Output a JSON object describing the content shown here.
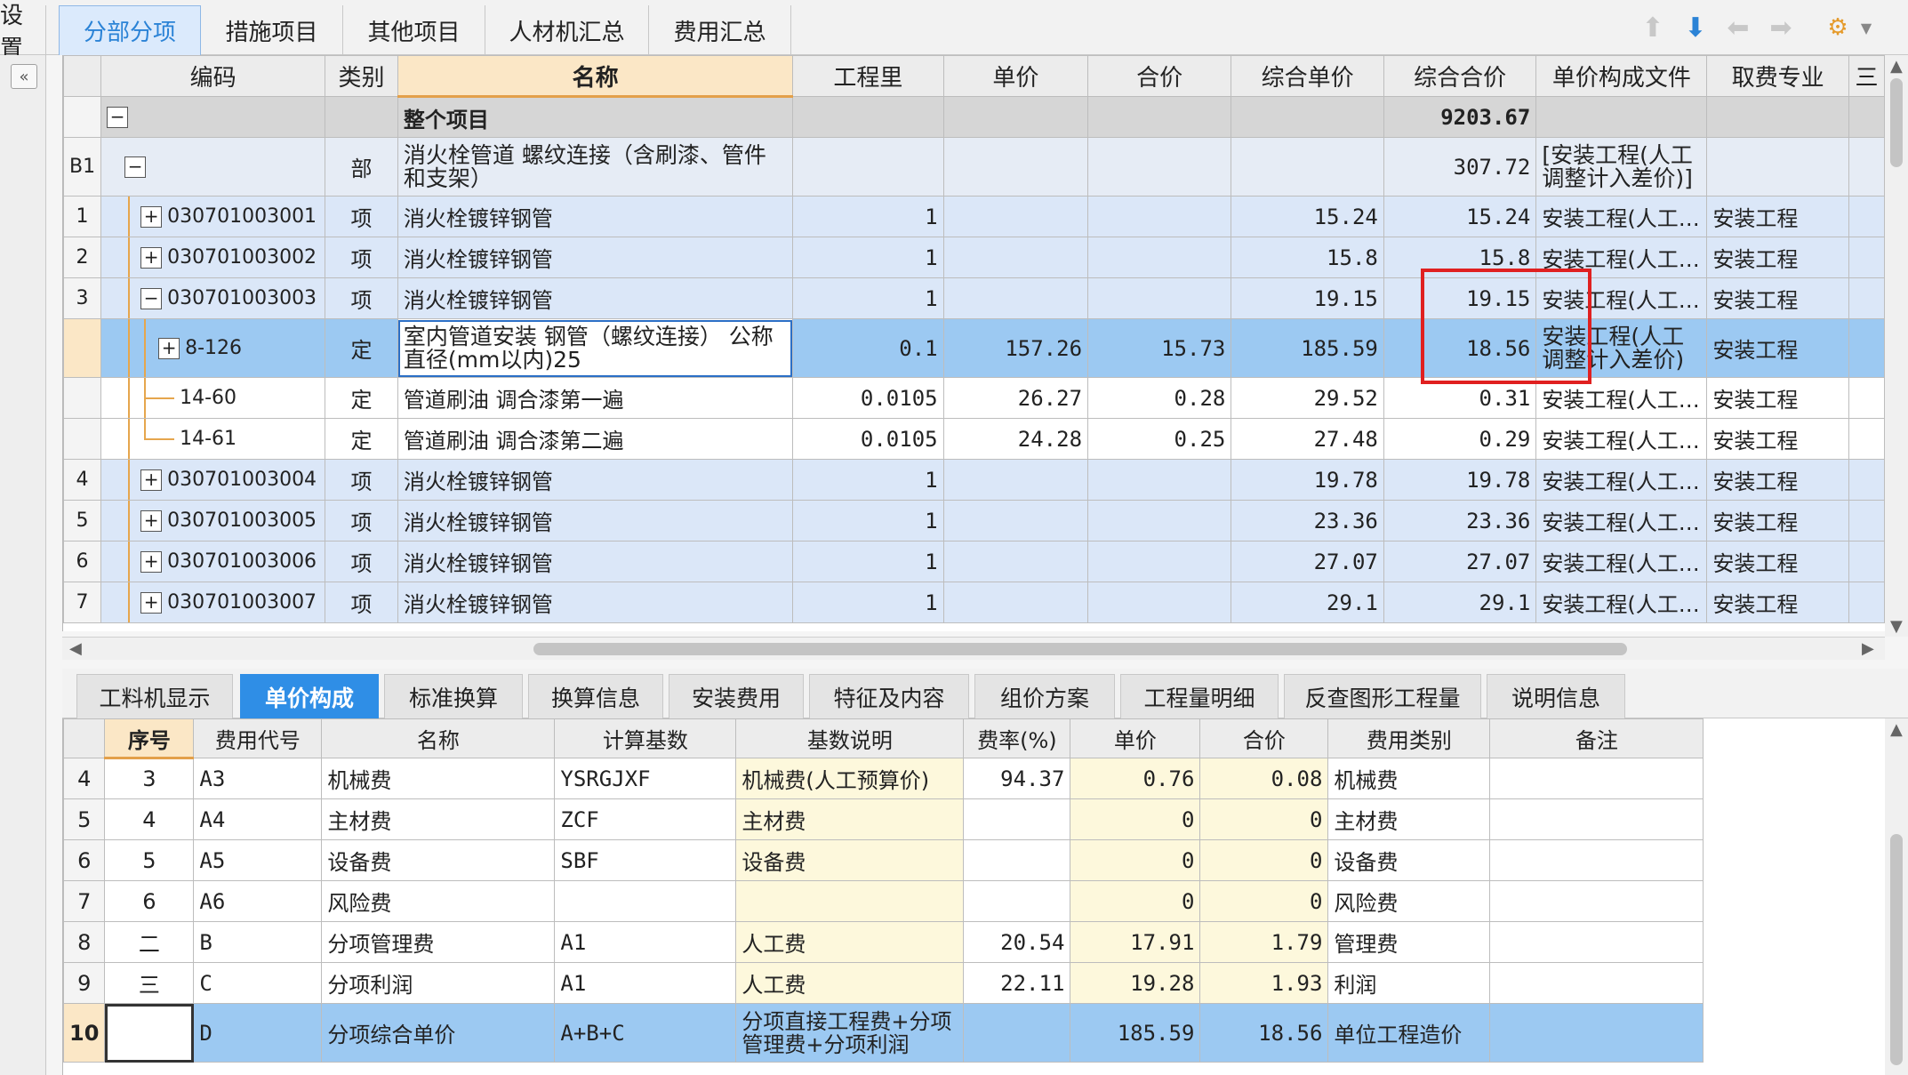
{
  "top_tabs": [
    {
      "label": "设置"
    },
    {
      "label": "分部分项"
    },
    {
      "label": "措施项目"
    },
    {
      "label": "其他项目"
    },
    {
      "label": "人材机汇总"
    },
    {
      "label": "费用汇总"
    }
  ],
  "toolbar_icons": [
    "arrow-up-icon",
    "arrow-down-icon",
    "arrow-left-icon",
    "arrow-right-icon",
    "settings-icon"
  ],
  "grid": {
    "headers": [
      "编码",
      "类别",
      "名称",
      "工程里",
      "单价",
      "合价",
      "综合单价",
      "综合合价",
      "单价构成文件",
      "取费专业",
      "三"
    ],
    "rows": [
      {
        "no": "",
        "code": "",
        "type": "",
        "name": "整个项目",
        "qty": "",
        "price": "",
        "total": "",
        "unit_comp": "",
        "total_comp": "9203.67",
        "file": "",
        "spec": ""
      },
      {
        "no": "B1",
        "code": "",
        "type": "部",
        "name": "消火栓管道 螺纹连接（含刷漆、管件和支架）",
        "qty": "",
        "price": "",
        "total": "",
        "unit_comp": "",
        "total_comp": "307.72",
        "file": "[安装工程(人工调整计入差价)]",
        "spec": ""
      },
      {
        "no": "1",
        "code": "030701003001",
        "type": "项",
        "name": "消火栓镀锌钢管",
        "qty": "1",
        "price": "",
        "total": "",
        "unit_comp": "15.24",
        "total_comp": "15.24",
        "file": "安装工程(人工…",
        "spec": "安装工程"
      },
      {
        "no": "2",
        "code": "030701003002",
        "type": "项",
        "name": "消火栓镀锌钢管",
        "qty": "1",
        "price": "",
        "total": "",
        "unit_comp": "15.8",
        "total_comp": "15.8",
        "file": "安装工程(人工…",
        "spec": "安装工程"
      },
      {
        "no": "3",
        "code": "030701003003",
        "type": "项",
        "name": "消火栓镀锌钢管",
        "qty": "1",
        "price": "",
        "total": "",
        "unit_comp": "19.15",
        "total_comp": "19.15",
        "file": "安装工程(人工…",
        "spec": "安装工程"
      },
      {
        "no": "",
        "code": "8-126",
        "type": "定",
        "name": "室内管道安装 钢管（螺纹连接） 公称直径(mm以内)25",
        "qty": "0.1",
        "price": "157.26",
        "total": "15.73",
        "unit_comp": "185.59",
        "total_comp": "18.56",
        "file": "安装工程(人工调整计入差价)",
        "spec": "安装工程"
      },
      {
        "no": "",
        "code": "14-60",
        "type": "定",
        "name": "管道刷油 调合漆第一遍",
        "qty": "0.0105",
        "price": "26.27",
        "total": "0.28",
        "unit_comp": "29.52",
        "total_comp": "0.31",
        "file": "安装工程(人工…",
        "spec": "安装工程"
      },
      {
        "no": "",
        "code": "14-61",
        "type": "定",
        "name": "管道刷油 调合漆第二遍",
        "qty": "0.0105",
        "price": "24.28",
        "total": "0.25",
        "unit_comp": "27.48",
        "total_comp": "0.29",
        "file": "安装工程(人工…",
        "spec": "安装工程"
      },
      {
        "no": "4",
        "code": "030701003004",
        "type": "项",
        "name": "消火栓镀锌钢管",
        "qty": "1",
        "price": "",
        "total": "",
        "unit_comp": "19.78",
        "total_comp": "19.78",
        "file": "安装工程(人工…",
        "spec": "安装工程"
      },
      {
        "no": "5",
        "code": "030701003005",
        "type": "项",
        "name": "消火栓镀锌钢管",
        "qty": "1",
        "price": "",
        "total": "",
        "unit_comp": "23.36",
        "total_comp": "23.36",
        "file": "安装工程(人工…",
        "spec": "安装工程"
      },
      {
        "no": "6",
        "code": "030701003006",
        "type": "项",
        "name": "消火栓镀锌钢管",
        "qty": "1",
        "price": "",
        "total": "",
        "unit_comp": "27.07",
        "total_comp": "27.07",
        "file": "安装工程(人工…",
        "spec": "安装工程"
      },
      {
        "no": "7",
        "code": "030701003007",
        "type": "项",
        "name": "消火栓镀锌钢管",
        "qty": "1",
        "price": "",
        "total": "",
        "unit_comp": "29.1",
        "total_comp": "29.1",
        "file": "安装工程(人工…",
        "spec": "安装工程"
      }
    ]
  },
  "sub_tabs": [
    {
      "label": "工料机显示"
    },
    {
      "label": "单价构成"
    },
    {
      "label": "标准换算"
    },
    {
      "label": "换算信息"
    },
    {
      "label": "安装费用"
    },
    {
      "label": "特征及内容"
    },
    {
      "label": "组价方案"
    },
    {
      "label": "工程量明细"
    },
    {
      "label": "反查图形工程量"
    },
    {
      "label": "说明信息"
    }
  ],
  "grid2": {
    "headers": [
      "序号",
      "费用代号",
      "名称",
      "计算基数",
      "基数说明",
      "费率(%)",
      "单价",
      "合价",
      "费用类别",
      "备注"
    ],
    "rows": [
      {
        "no": "4",
        "seq": "3",
        "code": "A3",
        "name": "机械费",
        "base": "YSRGJXF",
        "desc": "机械费(人工预算价)",
        "rate": "94.37",
        "price": "0.76",
        "total": "0.08",
        "cat": "机械费",
        "note": ""
      },
      {
        "no": "5",
        "seq": "4",
        "code": "A4",
        "name": "主材费",
        "base": "ZCF",
        "desc": "主材费",
        "rate": "",
        "price": "0",
        "total": "0",
        "cat": "主材费",
        "note": ""
      },
      {
        "no": "6",
        "seq": "5",
        "code": "A5",
        "name": "设备费",
        "base": "SBF",
        "desc": "设备费",
        "rate": "",
        "price": "0",
        "total": "0",
        "cat": "设备费",
        "note": ""
      },
      {
        "no": "7",
        "seq": "6",
        "code": "A6",
        "name": "风险费",
        "base": "",
        "desc": "",
        "rate": "",
        "price": "0",
        "total": "0",
        "cat": "风险费",
        "note": ""
      },
      {
        "no": "8",
        "seq": "二",
        "code": "B",
        "name": "分项管理费",
        "base": "A1",
        "desc": "人工费",
        "rate": "20.54",
        "price": "17.91",
        "total": "1.79",
        "cat": "管理费",
        "note": ""
      },
      {
        "no": "9",
        "seq": "三",
        "code": "C",
        "name": "分项利润",
        "base": "A1",
        "desc": "人工费",
        "rate": "22.11",
        "price": "19.28",
        "total": "1.93",
        "cat": "利润",
        "note": ""
      },
      {
        "no": "10",
        "seq": "",
        "code": "D",
        "name": "分项综合单价",
        "base": "A+B+C",
        "desc": "分项直接工程费+分项管理费+分项利润",
        "rate": "",
        "price": "185.59",
        "total": "18.56",
        "cat": "单位工程造价",
        "note": ""
      }
    ]
  }
}
